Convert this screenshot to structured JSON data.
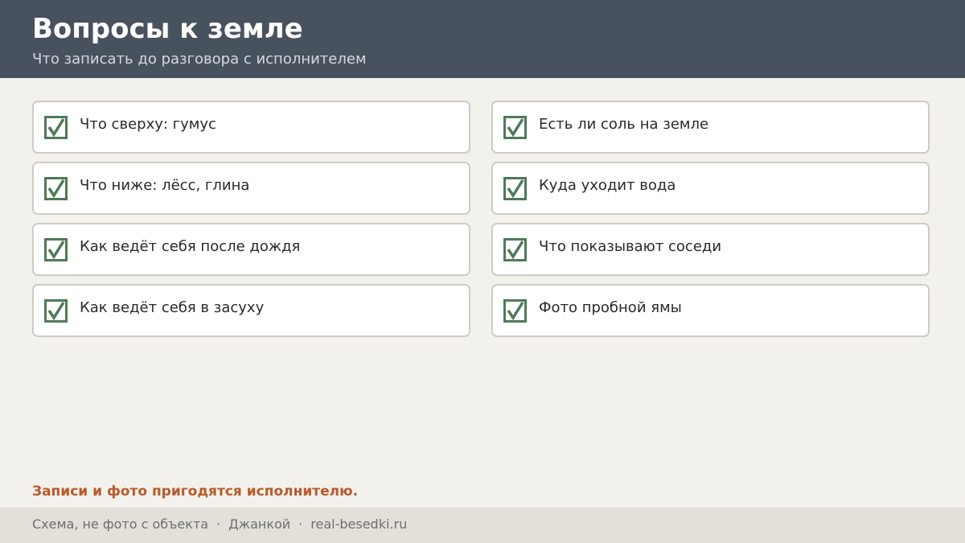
{
  "header": {
    "title": "Вопросы к земле",
    "subtitle": "Что записать до разговора с исполнителем"
  },
  "colors": {
    "header_bg": "#48525e",
    "check": "#4f7a56",
    "note": "#b85a2b"
  },
  "checklist": [
    {
      "label": "Что сверху: гумус",
      "checked": true,
      "icon": "checkbox-checked-icon"
    },
    {
      "label": "Есть ли соль на земле",
      "checked": true,
      "icon": "checkbox-checked-icon"
    },
    {
      "label": "Что ниже: лёсс, глина",
      "checked": true,
      "icon": "checkbox-checked-icon"
    },
    {
      "label": "Куда уходит вода",
      "checked": true,
      "icon": "checkbox-checked-icon"
    },
    {
      "label": "Как ведёт себя после дождя",
      "checked": true,
      "icon": "checkbox-checked-icon"
    },
    {
      "label": "Что показывают соседи",
      "checked": true,
      "icon": "checkbox-checked-icon"
    },
    {
      "label": "Как ведёт себя в засуху",
      "checked": true,
      "icon": "checkbox-checked-icon"
    },
    {
      "label": "Фото пробной ямы",
      "checked": true,
      "icon": "checkbox-checked-icon"
    }
  ],
  "note": "Записи и фото пригодятся исполнителю.",
  "footer": {
    "caption": "Схема, не фото с объекта",
    "separator": "·",
    "city": "Джанкой",
    "site": "real-besedki.ru"
  }
}
